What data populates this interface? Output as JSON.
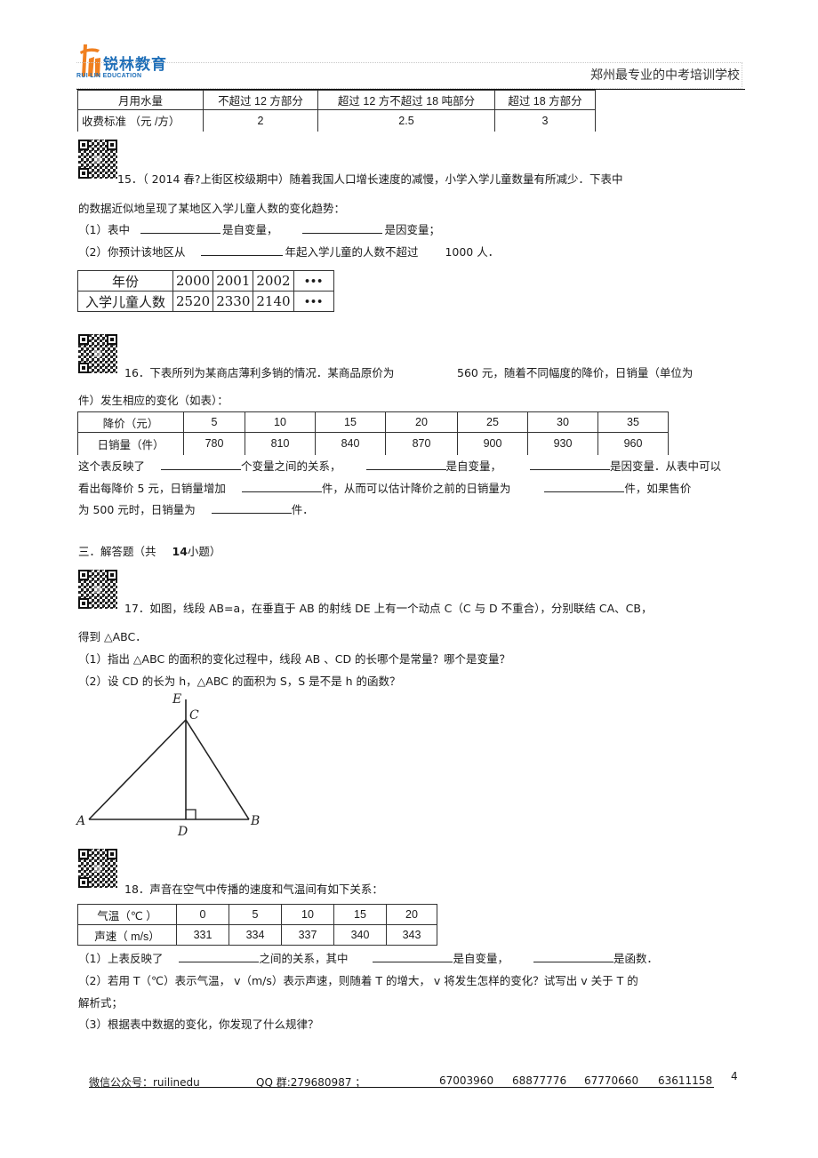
{
  "header": {
    "logo_cn": "锐林教育",
    "logo_en": "RUI LIN EDUCATION",
    "slogan": "郑州最专业的中考培训学校"
  },
  "table_top": {
    "rows": [
      [
        "月用水量",
        "不超过  12 方部分",
        "超过  12 方不超过   18 吨部分",
        "超过 18 方部分"
      ],
      [
        "收费标准 （元 /方）",
        "2",
        "2.5",
        "3"
      ]
    ]
  },
  "q15": {
    "line1": "15．（ 2014 春?上街区校级期中）随着我国人口增长速度的减慢，小学入学儿童数量有所减少．下表中",
    "line2": "的数据近似地呈现了某地区入学儿童人数的变化趋势：",
    "p1_a": "（1）表中",
    "p1_b": "是自变量，",
    "p1_c": "是因变量；",
    "p2_a": "（2）你预计该地区从",
    "p2_b": "年起入学儿童的人数不超过",
    "p2_c": "1000 人．",
    "table": {
      "rows": [
        [
          "年份",
          "2000",
          "2001",
          "2002",
          "•••"
        ],
        [
          "入学儿童人数",
          "2520",
          "2330",
          "2140",
          "•••"
        ]
      ]
    }
  },
  "q16": {
    "line1_a": "16．下表所列为某商店薄利多销的情况．某商品原价为",
    "line1_b": "560 元，随着不同幅度的降价，日销量（单位为",
    "line2": "件）发生相应的变化（如表）：",
    "table": {
      "rows": [
        [
          "降价（元）",
          "5",
          "10",
          "15",
          "20",
          "25",
          "30",
          "35"
        ],
        [
          "日销量（件）",
          "780",
          "810",
          "840",
          "870",
          "900",
          "930",
          "960"
        ]
      ]
    },
    "l3_a": "这个表反映了",
    "l3_b": "个变量之间的关系，",
    "l3_c": "是自变量，",
    "l3_d": "是因变量．从表中可以",
    "l4_a": "看出每降价   5 元，日销量增加",
    "l4_b": "件，从而可以估计降价之前的日销量为",
    "l4_c": "件，如果售价",
    "l5_a": "为 500 元时，日销量为",
    "l5_b": "件．"
  },
  "section3": {
    "title_a": "三．解答题（共",
    "title_b": "14",
    "title_c": "小题）"
  },
  "q17": {
    "line1": "17．如图，线段  AB=a，在垂直于   AB  的射线  DE  上有一个动点    C（C 与  D  不重合），分别联结   CA、CB，",
    "line2": "得到 △ABC．",
    "p1": "（1）指出  △ABC  的面积的变化过程中，线段      AB 、CD  的长哪个是常量？哪个是变量？",
    "p2": "（2）设  CD  的长为  h，△ABC  的面积为   S，S 是不是   h 的函数？",
    "figure": {
      "labels": {
        "A": "A",
        "B": "B",
        "C": "C",
        "D": "D",
        "E": "E"
      }
    }
  },
  "q18": {
    "line1": "18．声音在空气中传播的速度和气温间有如下关系：",
    "table": {
      "rows": [
        [
          "气温（℃ ）",
          "0",
          "5",
          "10",
          "15",
          "20"
        ],
        [
          "声速（  m/s）",
          "331",
          "334",
          "337",
          "340",
          "343"
        ]
      ]
    },
    "p1_a": "（1）上表反映了",
    "p1_b": "之间的关系，其中",
    "p1_c": "是自变量，",
    "p1_d": "是函数．",
    "p2_line1": "（2）若用  T（℃）表示气温，   v（m/s）表示声速，则随着     T 的增大，  v 将发生怎样的变化？试写出      v 关于  T 的",
    "p2_line2": "解析式；",
    "p3": "（3）根据表中数据的变化，你发现了什么规律？"
  },
  "footer": {
    "wechat": "微信公众号：ruilinedu",
    "qq": "QQ 群:279680987    ；",
    "phones": [
      "67003960",
      "68877776",
      "67770660",
      "63611158"
    ],
    "page_number": "4"
  }
}
